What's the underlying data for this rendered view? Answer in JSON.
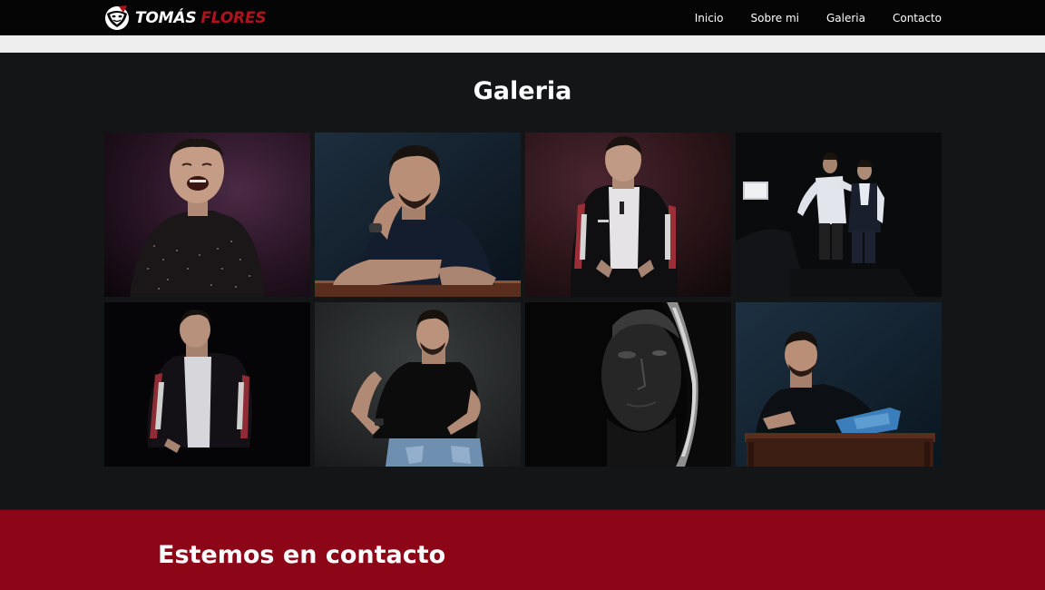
{
  "brand": {
    "first_name": "TOMÁS",
    "last_name": "FLORES",
    "accent_color": "#b3101e",
    "logo_icon": "theater-mask-icon"
  },
  "nav": {
    "items": [
      {
        "label": "Inicio"
      },
      {
        "label": "Sobre mi"
      },
      {
        "label": "Galeria"
      },
      {
        "label": "Contacto"
      }
    ]
  },
  "gallery": {
    "title": "Galeria",
    "photos": [
      {
        "subject": "laughing-portrait"
      },
      {
        "subject": "hand-on-chin-portrait"
      },
      {
        "subject": "leather-jacket-portrait"
      },
      {
        "subject": "stage-scene-two-actors"
      },
      {
        "subject": "leather-jacket-dark-portrait"
      },
      {
        "subject": "seated-black-shirt-portrait"
      },
      {
        "subject": "shadow-face-closeup"
      },
      {
        "subject": "reclining-on-table-portrait"
      }
    ]
  },
  "contact": {
    "title": "Estemos en contacto",
    "background_color": "#8d0617"
  }
}
